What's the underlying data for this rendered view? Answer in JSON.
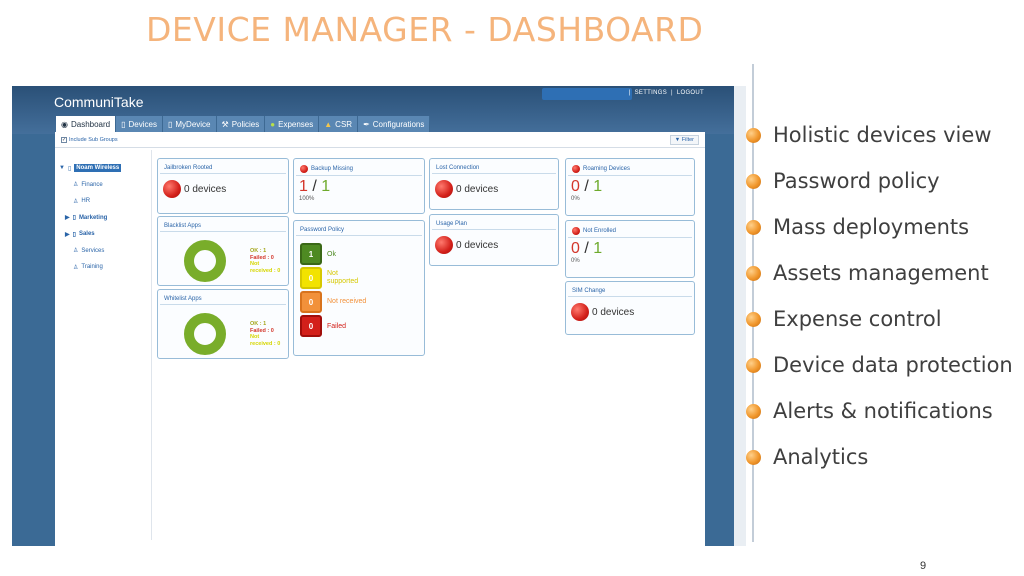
{
  "slide": {
    "title": "DEVICE MANAGER - DASHBOARD",
    "page_number": "9",
    "bullets": [
      "Holistic devices view",
      "Password policy",
      "Mass deployments",
      "Assets management",
      "Expense control",
      "Device data protection",
      "Alerts & notifications",
      "Analytics"
    ]
  },
  "app": {
    "logo": "CommuniTake",
    "settings": "SETTINGS",
    "logout": "LOGOUT",
    "tabs": [
      {
        "label": "Dashboard",
        "icon": "dashboard-icon"
      },
      {
        "label": "Devices",
        "icon": "phone-icon"
      },
      {
        "label": "MyDevice",
        "icon": "phone-icon"
      },
      {
        "label": "Policies",
        "icon": "tools-icon"
      },
      {
        "label": "Expenses",
        "icon": "money-icon"
      },
      {
        "label": "CSR",
        "icon": "person-icon"
      },
      {
        "label": "Configurations",
        "icon": "wrench-icon"
      }
    ],
    "include_subgroups": "Include Sub Groups",
    "filter": "Filter",
    "tree": {
      "root": "Noam Wireless",
      "children": [
        "Finance",
        "HR"
      ],
      "groups": [
        "Marketing",
        "Sales"
      ],
      "children2": [
        "Services",
        "Training"
      ]
    },
    "cards": {
      "jailbroken": {
        "title": "Jailbroken Rooted",
        "value": "0 devices"
      },
      "backup": {
        "title": "Backup Missing",
        "num": "1",
        "sep": "/",
        "den": "1",
        "pct": "100%"
      },
      "lost": {
        "title": "Lost Connection",
        "value": "0 devices"
      },
      "roaming": {
        "title": "Roaming Devices",
        "num": "0",
        "sep": "/",
        "den": "1",
        "pct": "0%"
      },
      "blacklist": {
        "title": "Blacklist Apps",
        "ok": "OK : 1",
        "failed": "Failed : 0",
        "not": "Not",
        "received": "received : 0"
      },
      "password": {
        "title": "Password Policy",
        "rows": [
          {
            "count": "1",
            "label": "Ok"
          },
          {
            "count": "0",
            "label": "Not supported"
          },
          {
            "count": "0",
            "label": "Not received"
          },
          {
            "count": "0",
            "label": "Failed"
          }
        ]
      },
      "usage": {
        "title": "Usage Plan",
        "value": "0 devices"
      },
      "enrolled": {
        "title": "Not Enrolled",
        "num": "0",
        "sep": "/",
        "den": "1",
        "pct": "0%"
      },
      "whitelist": {
        "title": "Whitelist Apps",
        "ok": "OK : 1",
        "failed": "Failed : 0",
        "not": "Not",
        "received": "received : 0"
      },
      "sim": {
        "title": "SIM Change",
        "value": "0 devices"
      }
    }
  }
}
